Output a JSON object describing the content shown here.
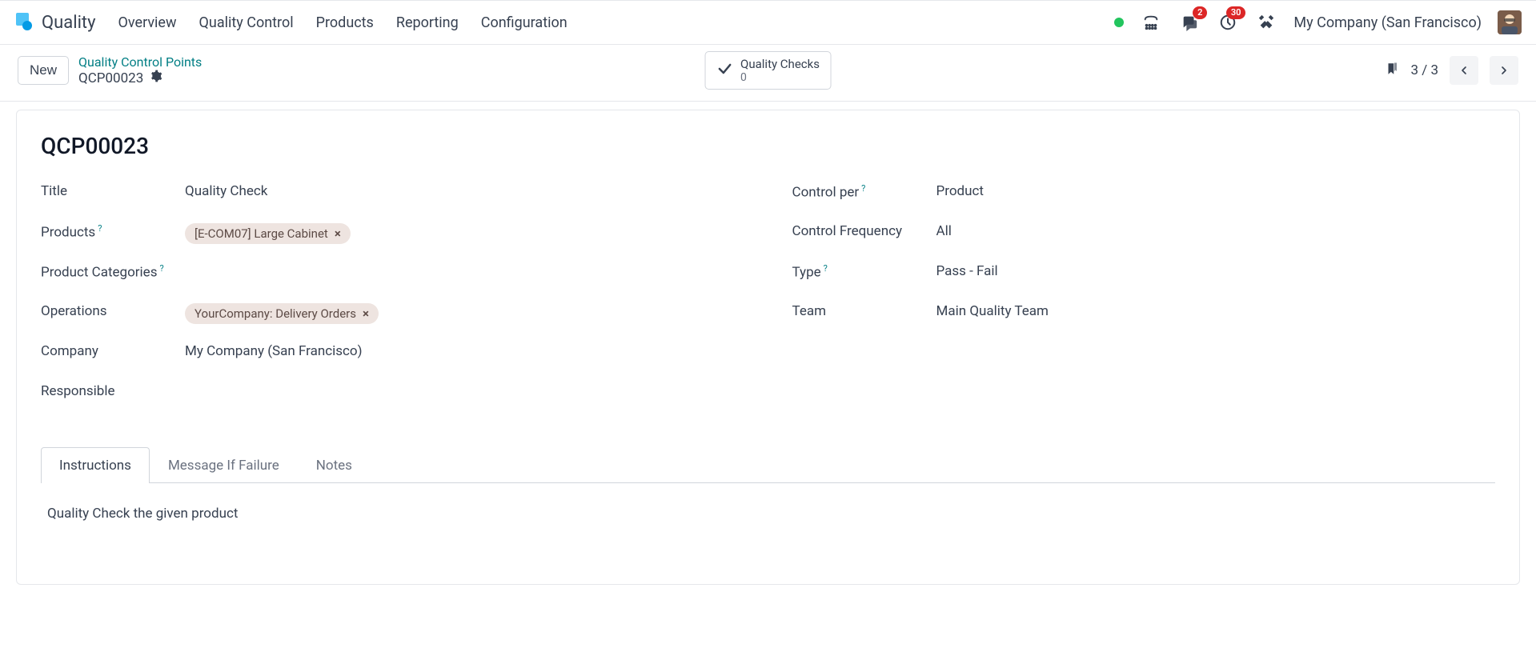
{
  "app_name": "Quality",
  "nav": {
    "items": [
      "Overview",
      "Quality Control",
      "Products",
      "Reporting",
      "Configuration"
    ]
  },
  "header": {
    "messages_badge": "2",
    "activities_badge": "30",
    "company": "My Company (San Francisco)"
  },
  "control": {
    "new_label": "New",
    "breadcrumb_parent": "Quality Control Points",
    "breadcrumb_current": "QCP00023",
    "stat_label": "Quality Checks",
    "stat_value": "0",
    "pager": "3 / 3"
  },
  "record": {
    "name": "QCP00023",
    "fields_left": {
      "title_label": "Title",
      "title_value": "Quality Check",
      "products_label": "Products",
      "products_tag": "[E-COM07] Large Cabinet",
      "product_categories_label": "Product Categories",
      "operations_label": "Operations",
      "operations_tag": "YourCompany: Delivery Orders",
      "company_label": "Company",
      "company_value": "My Company (San Francisco)",
      "responsible_label": "Responsible"
    },
    "fields_right": {
      "control_per_label": "Control per",
      "control_per_value": "Product",
      "control_frequency_label": "Control Frequency",
      "control_frequency_value": "All",
      "type_label": "Type",
      "type_value": "Pass - Fail",
      "team_label": "Team",
      "team_value": "Main Quality Team"
    }
  },
  "tabs": {
    "items": [
      "Instructions",
      "Message If Failure",
      "Notes"
    ],
    "instructions_content": "Quality Check the given product"
  }
}
